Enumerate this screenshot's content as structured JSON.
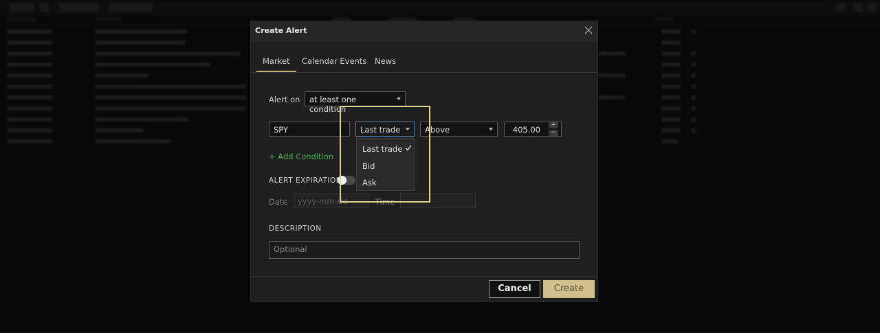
{
  "dialog": {
    "title": "Create Alert",
    "tabs": [
      {
        "label": "Market",
        "active": true
      },
      {
        "label": "Calendar Events",
        "active": false
      },
      {
        "label": "News",
        "active": false
      }
    ]
  },
  "alert_on": {
    "label": "Alert on",
    "selected": "at least one condition"
  },
  "condition": {
    "symbol": "SPY",
    "field": "Last trade",
    "operator": "Above",
    "value": "405.00",
    "increment_label": "+",
    "decrement_label": "−"
  },
  "field_dropdown": {
    "options": [
      "Last trade",
      "Bid",
      "Ask"
    ],
    "selected": "Last trade"
  },
  "add_condition_label": "+ Add Condition",
  "expiration": {
    "title": "ALERT EXPIRATION",
    "enabled": false,
    "date_label": "Date",
    "date_placeholder": "yyyy-mm-dd",
    "time_label": "Time",
    "time_placeholder": ""
  },
  "description": {
    "title": "DESCRIPTION",
    "placeholder": "Optional"
  },
  "buttons": {
    "cancel": "Cancel",
    "create": "Create"
  },
  "colors": {
    "accent": "#c8b27a",
    "create_button": "#d1bf8c",
    "add_condition": "#3fb34f",
    "highlight": "#e6d38e"
  },
  "icons": {
    "close": "close-icon",
    "caret": "chevron-down-icon",
    "check": "check-icon"
  }
}
